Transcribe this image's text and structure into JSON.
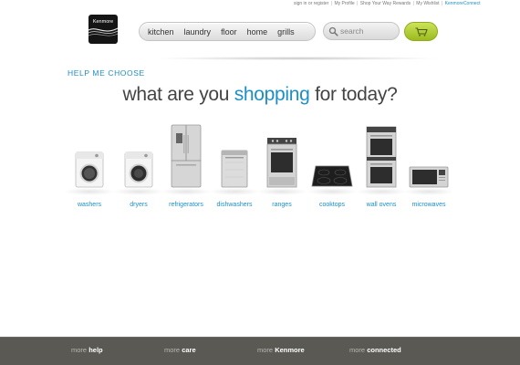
{
  "utility_links": {
    "signin": "sign in or register",
    "sep": "|",
    "profile": "My Profile",
    "rewards": "Shop Your Way Rewards",
    "wishlist": "My Wishlist",
    "connect": "KenmoreConnect"
  },
  "brand": {
    "name": "Kenmore"
  },
  "nav": [
    "kitchen",
    "laundry",
    "floor",
    "home",
    "grills"
  ],
  "search": {
    "placeholder": "search"
  },
  "colors": {
    "accent": "#1d8fc4",
    "cart": "#b3d03a",
    "footer_bg": "#5a5954"
  },
  "help_title": "HELP ME CHOOSE",
  "headline": {
    "before": "what are you ",
    "highlight": "shopping",
    "after": " for today?"
  },
  "products": [
    {
      "label": "washers",
      "icon": "washer-icon"
    },
    {
      "label": "dryers",
      "icon": "dryer-icon"
    },
    {
      "label": "refrigerators",
      "icon": "refrigerator-icon"
    },
    {
      "label": "dishwashers",
      "icon": "dishwasher-icon"
    },
    {
      "label": "ranges",
      "icon": "range-icon"
    },
    {
      "label": "cooktops",
      "icon": "cooktop-icon"
    },
    {
      "label": "wall ovens",
      "icon": "wall-oven-icon"
    },
    {
      "label": "microwaves",
      "icon": "microwave-icon"
    }
  ],
  "footer": {
    "help": {
      "prefix": "more",
      "word": "help"
    },
    "care": {
      "prefix": "more",
      "word": "care"
    },
    "kenmore": {
      "prefix": "more",
      "word": "Kenmore"
    },
    "connected": {
      "prefix": "more",
      "word": "connected"
    }
  }
}
